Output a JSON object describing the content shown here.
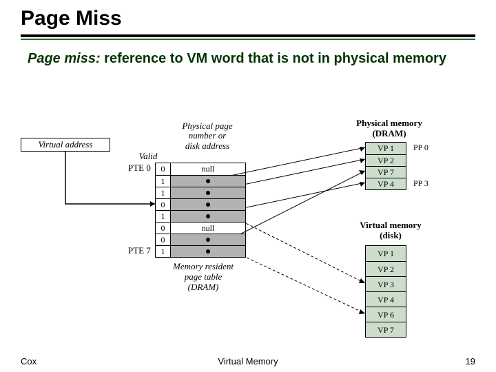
{
  "title": "Page Miss",
  "subtitle_em": "Page miss:",
  "subtitle_rest": " reference to VM word that is not in physical memory",
  "va_label": "Virtual address",
  "valid_hdr": "Valid",
  "addr_hdr": "Physical page\nnumber or\ndisk address",
  "pte_first": "PTE 0",
  "pte_last": "PTE 7",
  "page_table": [
    {
      "valid": "0",
      "addr": "null",
      "shaded": false,
      "dot": false
    },
    {
      "valid": "1",
      "addr": "",
      "shaded": true,
      "dot": true
    },
    {
      "valid": "1",
      "addr": "",
      "shaded": true,
      "dot": true
    },
    {
      "valid": "0",
      "addr": "",
      "shaded": true,
      "dot": true
    },
    {
      "valid": "1",
      "addr": "",
      "shaded": true,
      "dot": true
    },
    {
      "valid": "0",
      "addr": "null",
      "shaded": false,
      "dot": false
    },
    {
      "valid": "0",
      "addr": "",
      "shaded": true,
      "dot": true
    },
    {
      "valid": "1",
      "addr": "",
      "shaded": true,
      "dot": true
    }
  ],
  "pm_label": "Physical memory\n(DRAM)",
  "pm_rows": [
    "VP 1",
    "VP 2",
    "VP 7",
    "VP 4"
  ],
  "pp_labels": [
    "PP 0",
    "PP 3"
  ],
  "vm_label": "Virtual memory\n(disk)",
  "vm_rows": [
    "VP 1",
    "VP 2",
    "VP 3",
    "VP 4",
    "VP 6",
    "VP 7"
  ],
  "mrp_label": "Memory resident\npage table\n(DRAM)",
  "footer": {
    "author": "Cox",
    "title": "Virtual Memory",
    "page": "19"
  }
}
